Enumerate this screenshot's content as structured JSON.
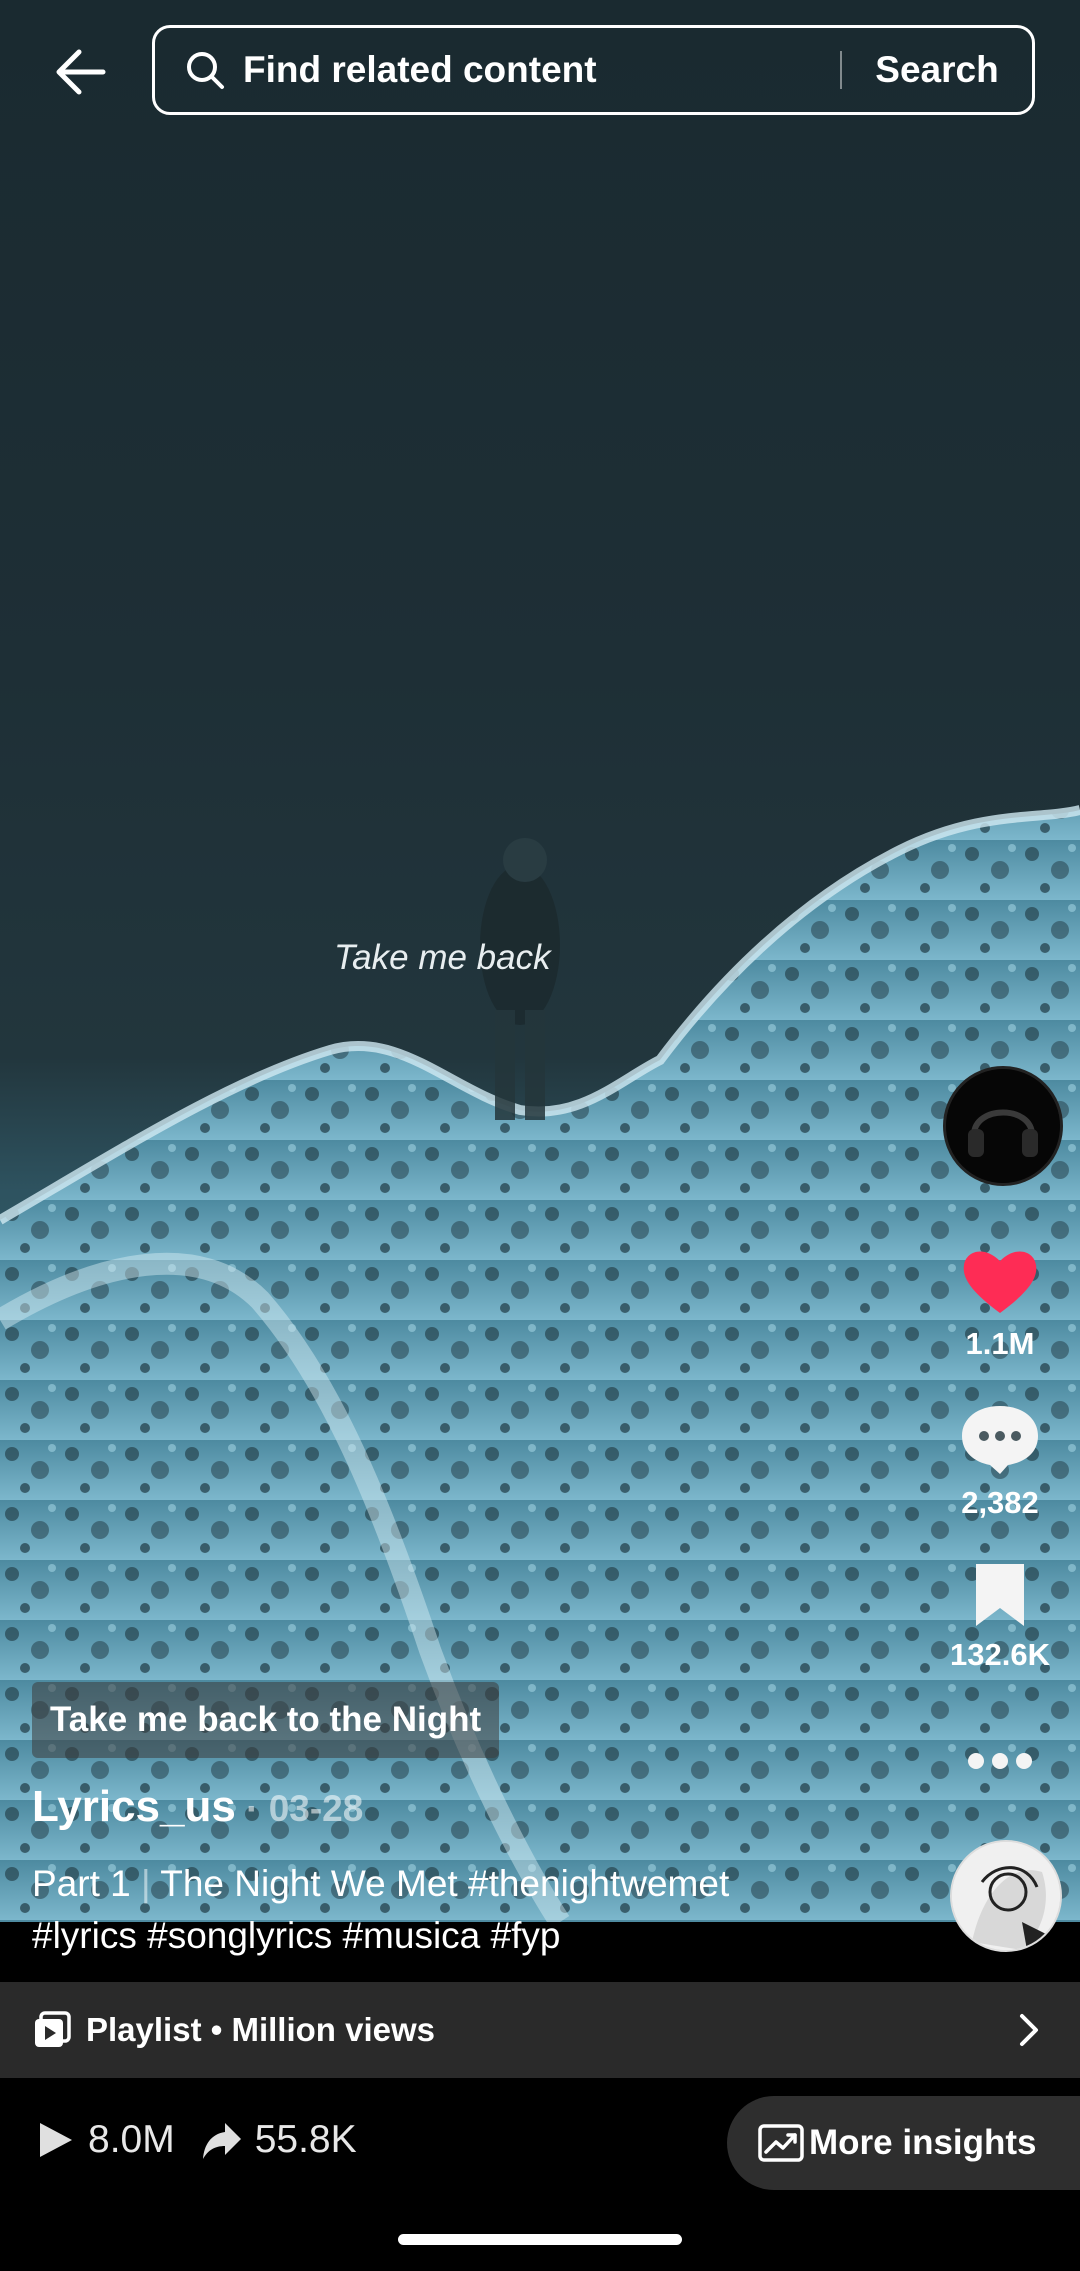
{
  "header": {
    "search_placeholder": "Find related content",
    "search_button": "Search",
    "icons": [
      "back-arrow-icon",
      "search-icon"
    ]
  },
  "video": {
    "overlay_text": "Take me back"
  },
  "rail": {
    "likes": "1.1M",
    "comments": "2,382",
    "saves": "132.6K",
    "like_color": "#fe2c55",
    "icons": [
      "heart-icon",
      "comment-icon",
      "bookmark-icon",
      "more-icon"
    ]
  },
  "post": {
    "caption_chip": "Take me back to the Night",
    "author": "Lyrics_us",
    "date": " · 03-28",
    "desc_part": "Part 1",
    "desc_sep": " | ",
    "desc_title": "The Night We Met #thenightwemet",
    "desc_tags": "#lyrics #songlyrics #musica #fyp"
  },
  "playlist": {
    "label": "Playlist • Million views",
    "icons": [
      "playlist-icon",
      "chevron-right-icon"
    ]
  },
  "stats": {
    "plays": "8.0M",
    "shares": "55.8K",
    "more_insights": "More insights",
    "icons": [
      "play-icon",
      "share-icon",
      "insights-chart-icon"
    ]
  }
}
